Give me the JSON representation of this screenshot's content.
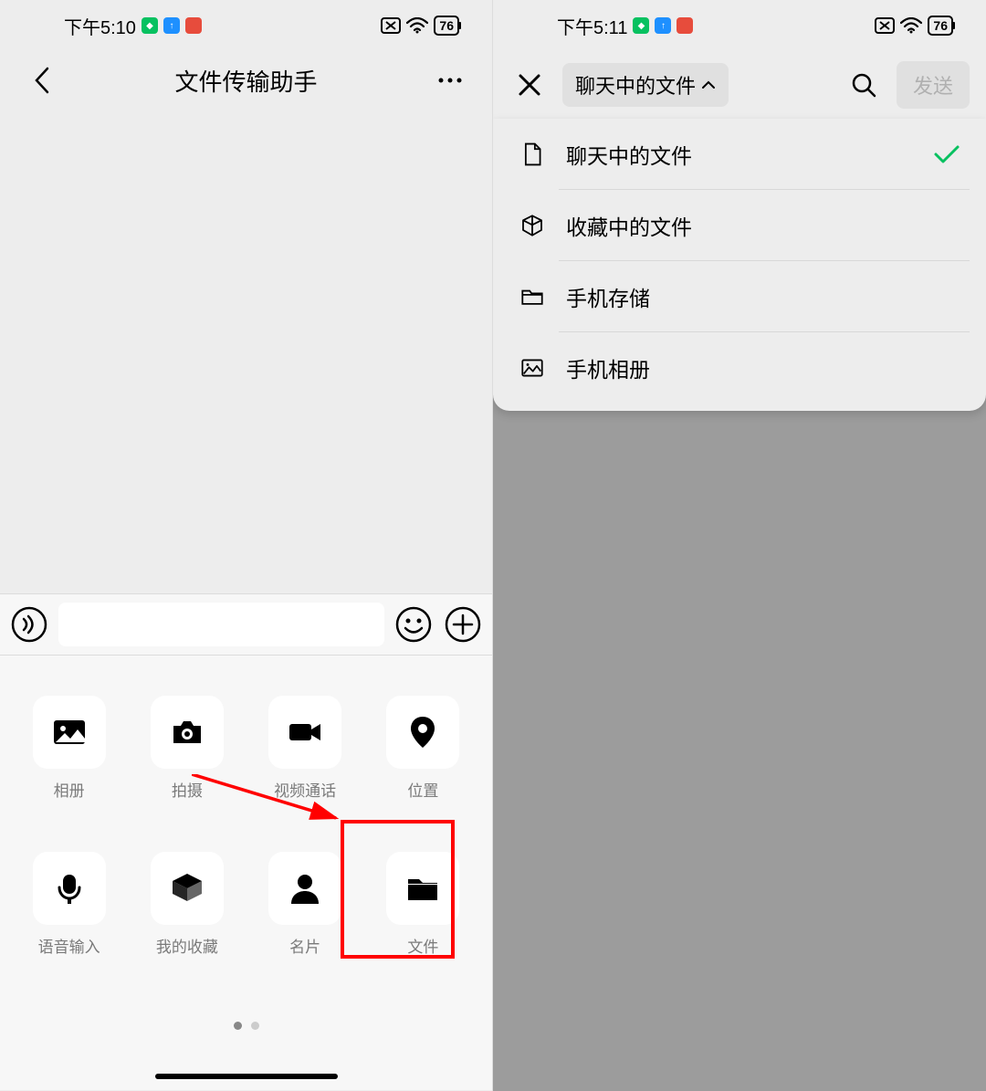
{
  "left": {
    "status_time": "下午5:10",
    "battery": "76",
    "title": "文件传输助手",
    "grid": [
      {
        "label": "相册",
        "icon": "photo"
      },
      {
        "label": "拍摄",
        "icon": "camera"
      },
      {
        "label": "视频通话",
        "icon": "video"
      },
      {
        "label": "位置",
        "icon": "location"
      },
      {
        "label": "语音输入",
        "icon": "mic"
      },
      {
        "label": "我的收藏",
        "icon": "box"
      },
      {
        "label": "名片",
        "icon": "person"
      },
      {
        "label": "文件",
        "icon": "folder"
      }
    ]
  },
  "right": {
    "status_time": "下午5:11",
    "battery": "76",
    "dropdown_label": "聊天中的文件",
    "send_label": "发送",
    "options": [
      {
        "label": "聊天中的文件",
        "icon": "file",
        "selected": true
      },
      {
        "label": "收藏中的文件",
        "icon": "cube",
        "selected": false
      },
      {
        "label": "手机存储",
        "icon": "folder-outline",
        "selected": false
      },
      {
        "label": "手机相册",
        "icon": "image",
        "selected": false
      }
    ]
  }
}
